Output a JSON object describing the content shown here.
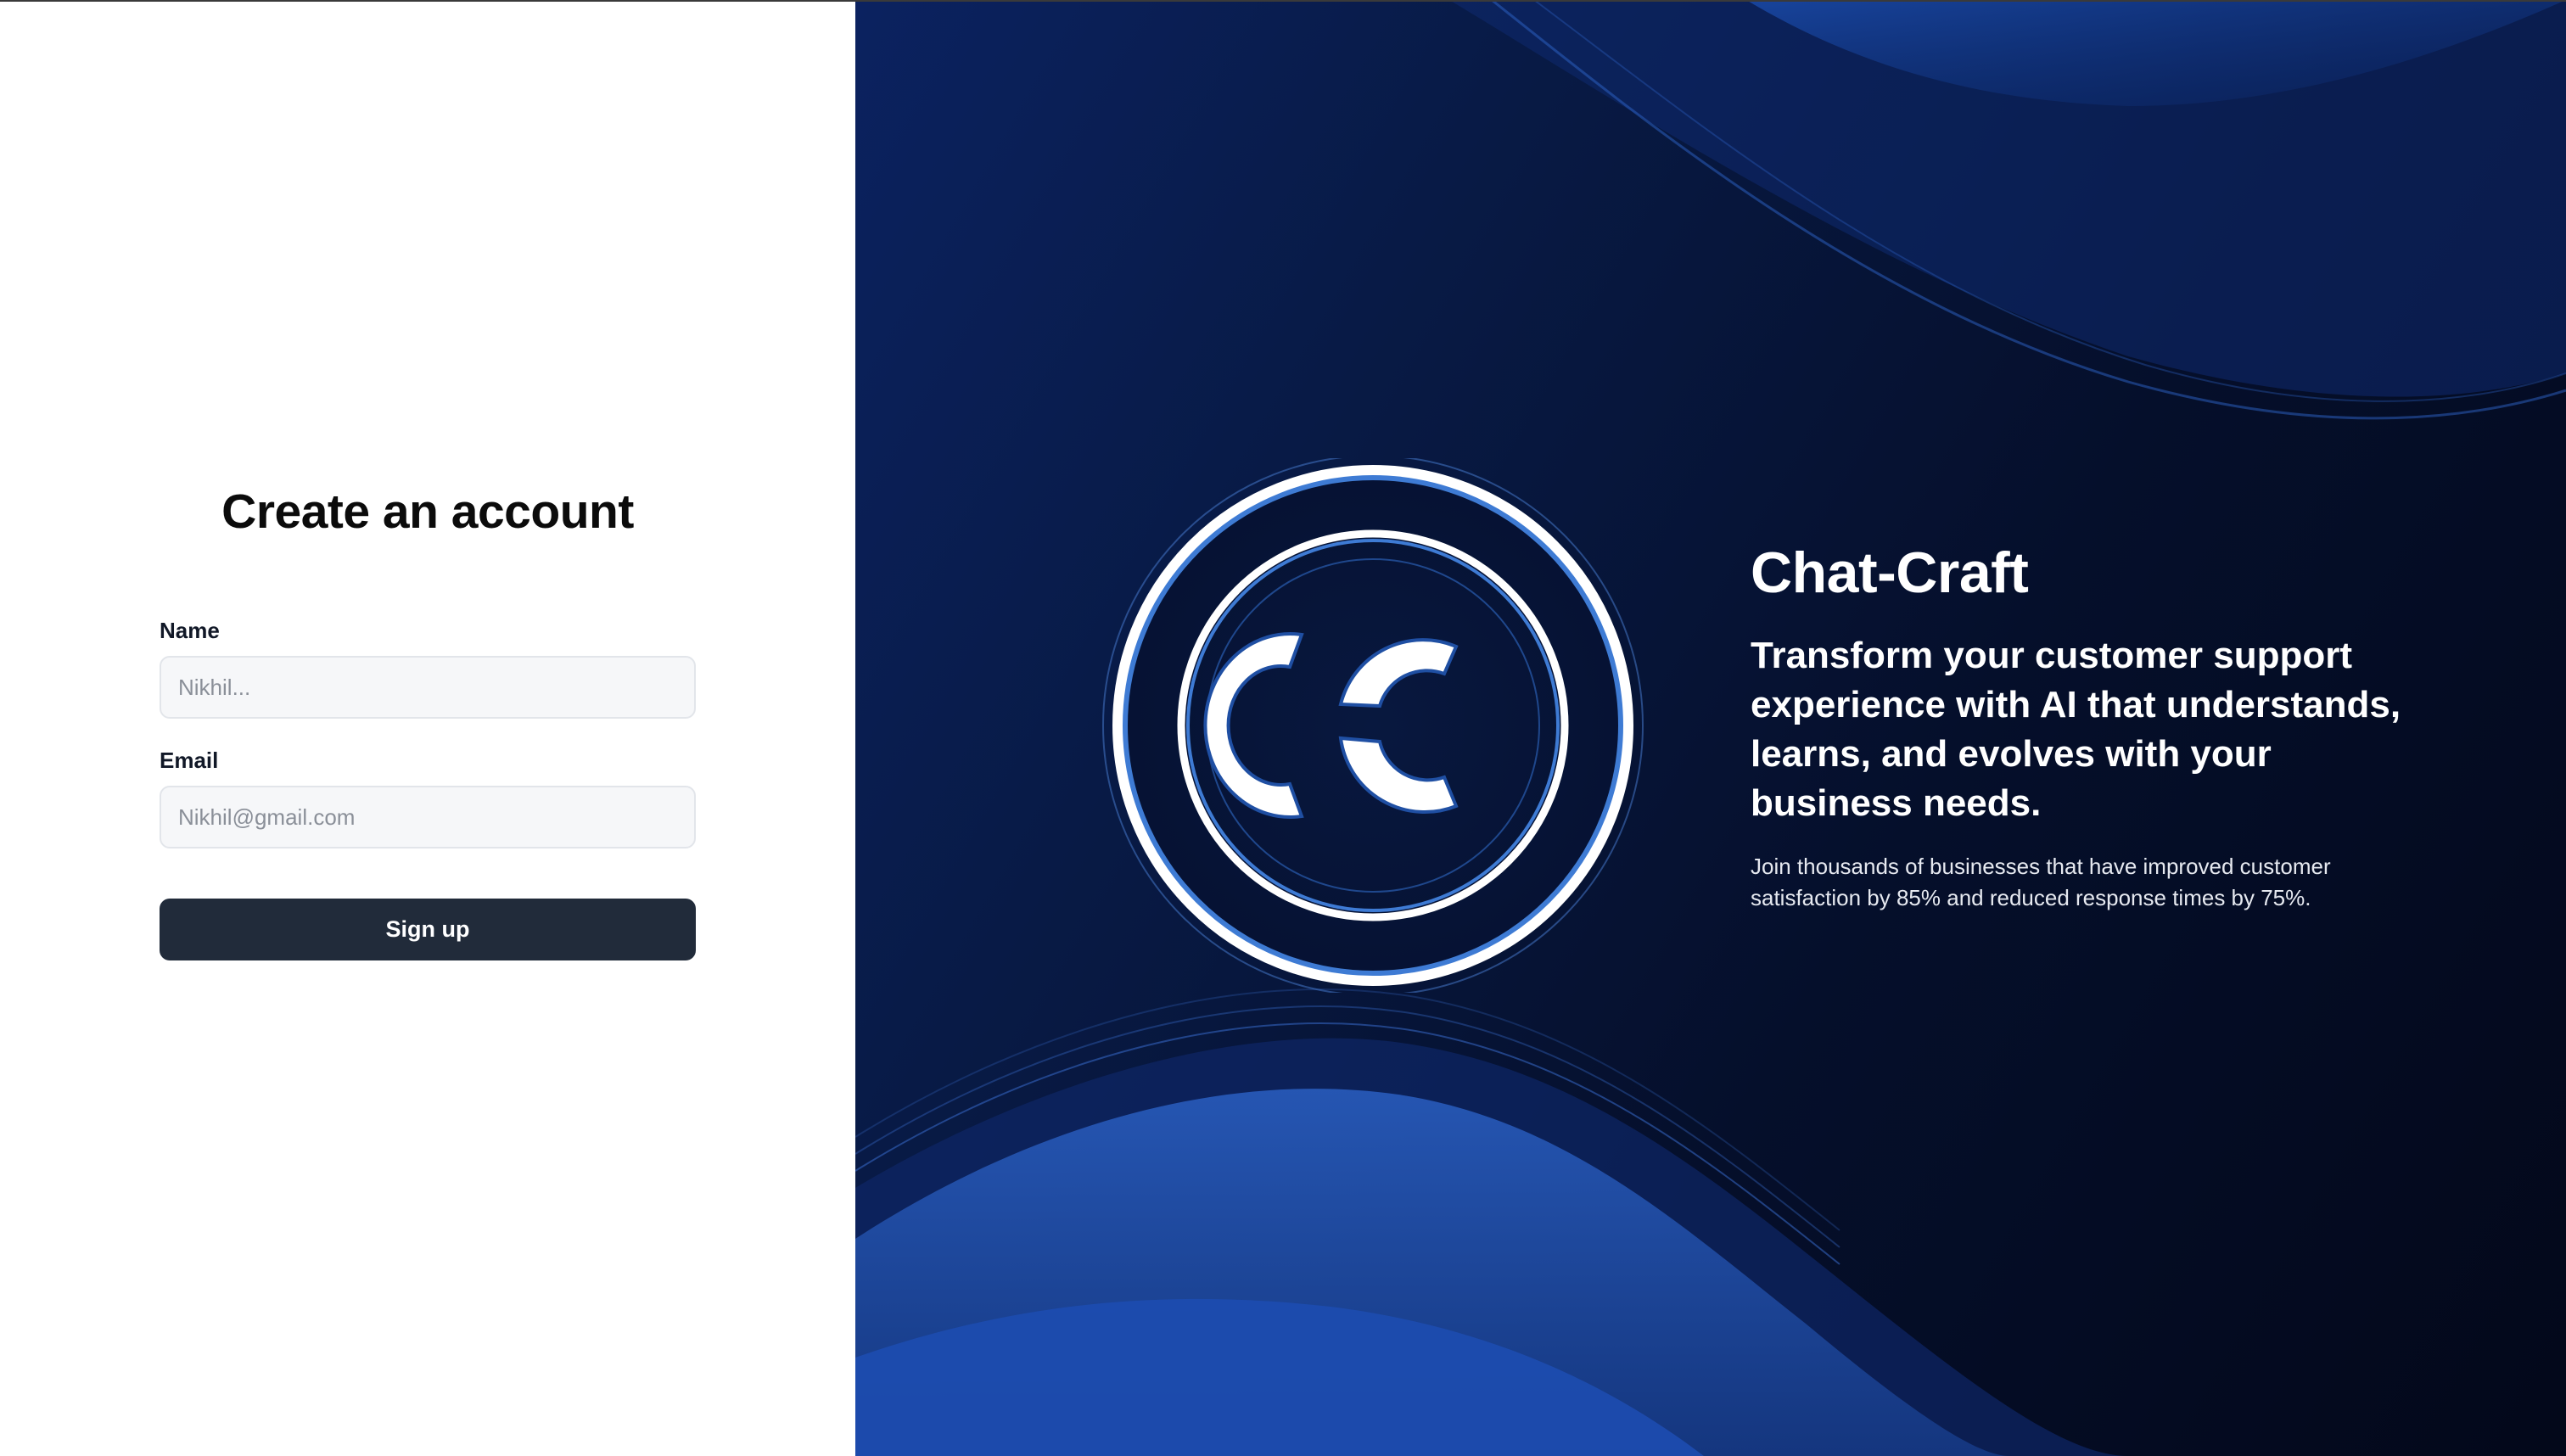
{
  "signup_form": {
    "title": "Create an account",
    "name_label": "Name",
    "name_placeholder": "Nikhil...",
    "name_value": "",
    "email_label": "Email",
    "email_placeholder": "Nikhil@gmail.com",
    "email_value": "",
    "submit_label": "Sign up"
  },
  "hero": {
    "logo_text": "CC",
    "title": "Chat-Craft",
    "tagline": "Transform your customer support experience with AI that understands, learns, and evolves with your business needs.",
    "subtext": "Join thousands of businesses that have improved customer satisfaction by 85% and reduced response times by 75%."
  },
  "colors": {
    "button_bg": "#212b3a",
    "hero_bg_dark": "#03081a",
    "hero_bg_blue": "#0b2260",
    "accent_blue": "#2f6bd6"
  },
  "icons": {
    "logo": "chat-craft-cc-logo"
  }
}
